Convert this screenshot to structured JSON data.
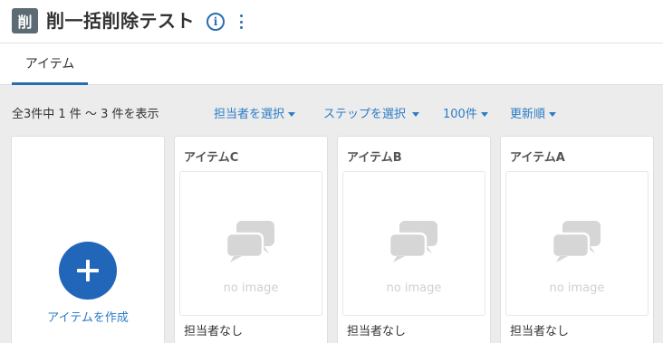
{
  "header": {
    "app_icon_text": "削",
    "title": "削一括削除テスト"
  },
  "tabs": [
    {
      "label": "アイテム"
    }
  ],
  "toolbar": {
    "count_text": "全3件中 1 件 ～ 3 件を表示",
    "filters": [
      {
        "label": "担当者を選択"
      },
      {
        "label": "ステップを選択"
      },
      {
        "label": "100件"
      },
      {
        "label": "更新順"
      }
    ]
  },
  "create_card": {
    "label": "アイテムを作成"
  },
  "items": [
    {
      "title": "アイテムC",
      "placeholder": "no image",
      "assignee": "担当者なし"
    },
    {
      "title": "アイテムB",
      "placeholder": "no image",
      "assignee": "担当者なし"
    },
    {
      "title": "アイテムA",
      "placeholder": "no image",
      "assignee": "担当者なし"
    }
  ],
  "colors": {
    "accent": "#2b6cb0",
    "link": "#2b7cc7",
    "create_button": "#2166b8"
  },
  "icons": {
    "info": "info-icon",
    "more": "more-vertical-icon",
    "add": "plus-icon",
    "placeholder": "speech-bubbles-icon"
  }
}
